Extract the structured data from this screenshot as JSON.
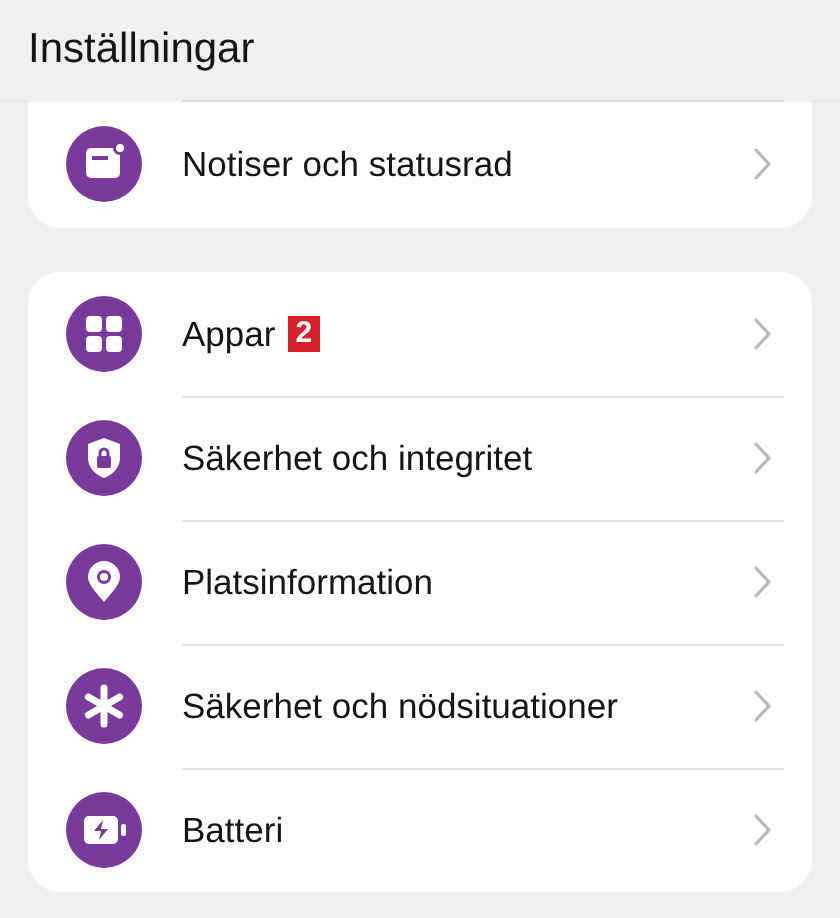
{
  "header": {
    "title": "Inställningar"
  },
  "groups": [
    {
      "items": [
        {
          "kind": "notification",
          "label": "Notiser och statusrad"
        }
      ]
    },
    {
      "items": [
        {
          "kind": "apps",
          "label": "Appar",
          "badge": "2"
        },
        {
          "kind": "privacy",
          "label": "Säkerhet och integritet"
        },
        {
          "kind": "location",
          "label": "Platsinformation"
        },
        {
          "kind": "emergency",
          "label": "Säkerhet och nödsituationer"
        },
        {
          "kind": "battery",
          "label": "Batteri"
        }
      ]
    }
  ]
}
